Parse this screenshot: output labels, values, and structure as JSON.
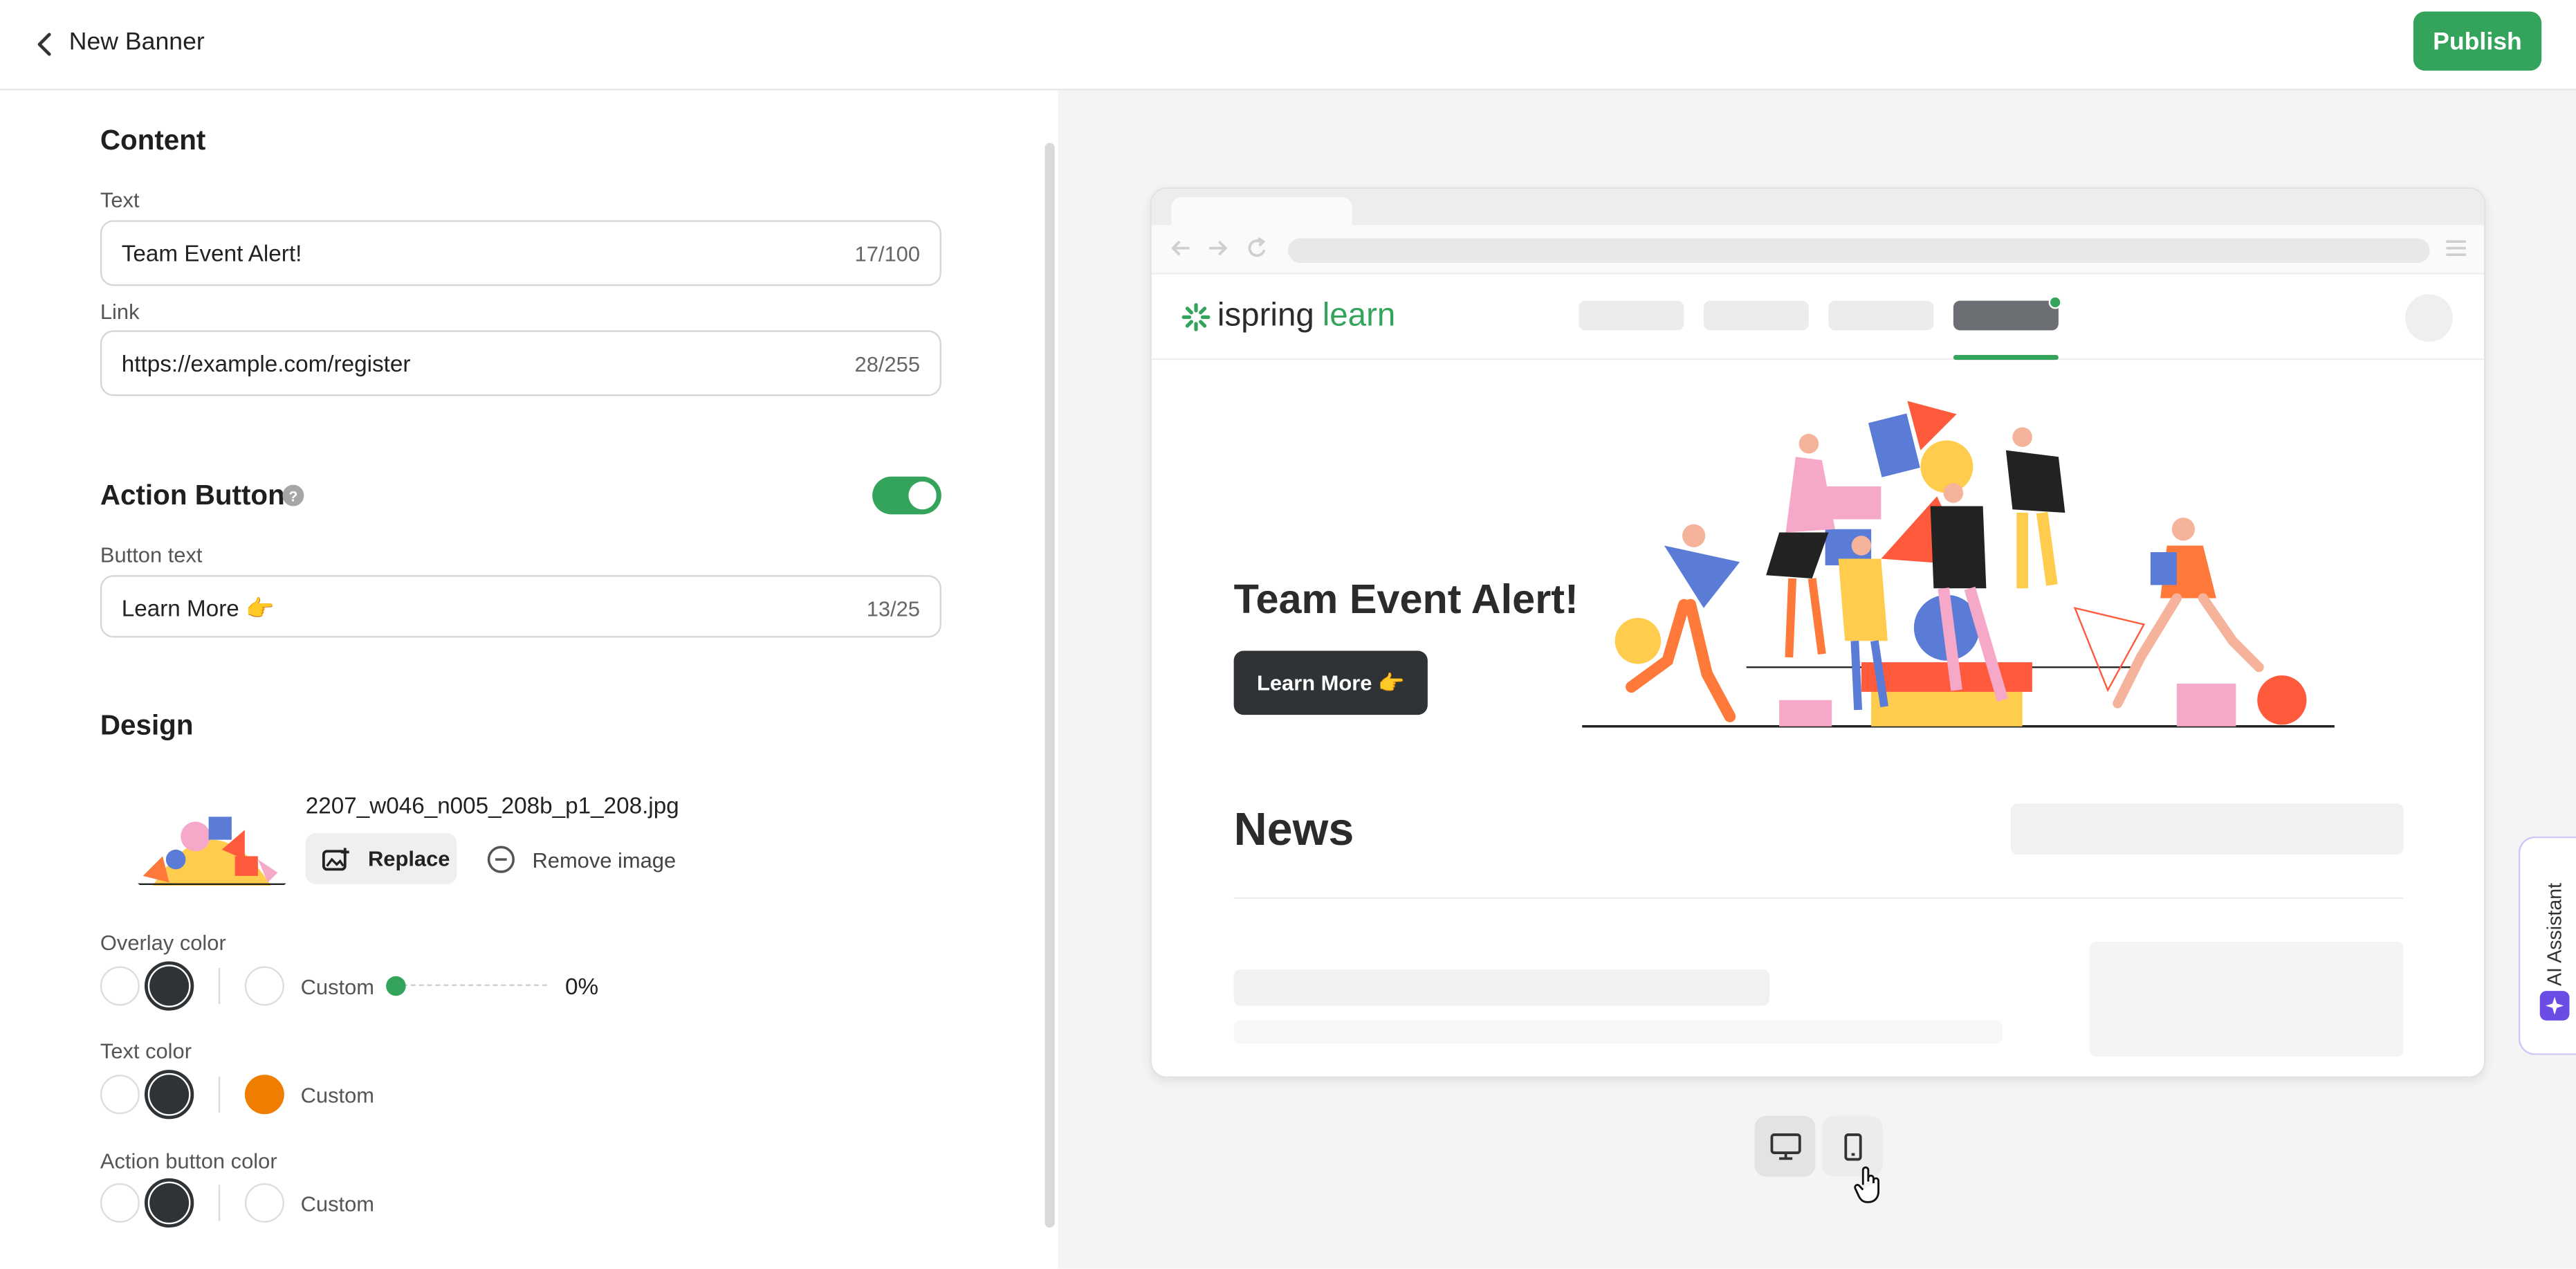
{
  "header": {
    "title": "New Banner",
    "publish_label": "Publish"
  },
  "content": {
    "heading": "Content",
    "text_label": "Text",
    "text_value": "Team Event Alert!",
    "text_count": "17/100",
    "link_label": "Link",
    "link_value": "https://example.com/register",
    "link_count": "28/255"
  },
  "action_button": {
    "heading": "Action Button",
    "help_symbol": "?",
    "enabled": true,
    "button_text_label": "Button text",
    "button_text_value": "Learn More 👉",
    "button_text_count": "13/25"
  },
  "design": {
    "heading": "Design",
    "file_name": "2207_w046_n005_208b_p1_208.jpg",
    "replace_label": "Replace",
    "remove_label": "Remove image",
    "overlay_label": "Overlay color",
    "overlay_custom": "Custom",
    "overlay_opacity": "0%",
    "text_color_label": "Text color",
    "text_color_custom": "Custom",
    "text_custom_color": "#ef7d00",
    "action_color_label": "Action button color",
    "action_color_custom": "Custom"
  },
  "preview": {
    "logo_word1": "ispring",
    "logo_word2": "learn",
    "banner_title": "Team Event Alert!",
    "banner_button": "Learn More 👉",
    "news_title": "News"
  },
  "ai_assistant": {
    "label": "AI Assistant"
  },
  "colors": {
    "accent": "#34a35b",
    "dark": "#2f3336",
    "ai": "#6b4de6"
  }
}
